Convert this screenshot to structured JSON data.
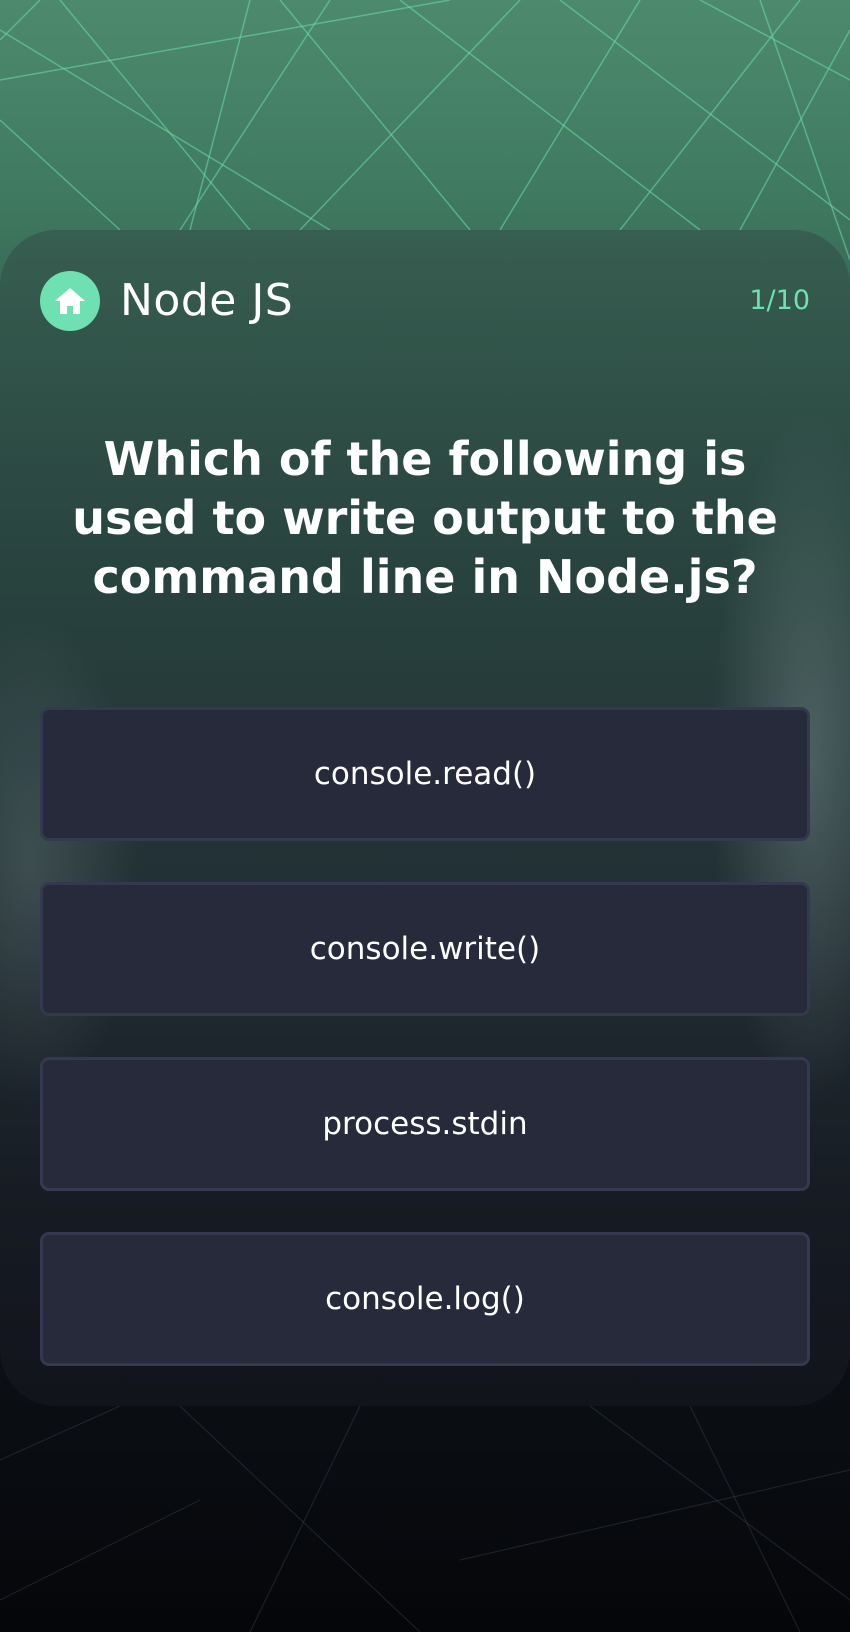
{
  "header": {
    "home_icon": "home-icon",
    "title": "Node JS",
    "progress": "1/10"
  },
  "question": {
    "text": "Which of the following is used to write output to the command line in Node.js?"
  },
  "answers": [
    {
      "label": "console.read()"
    },
    {
      "label": "console.write()"
    },
    {
      "label": "process.stdin"
    },
    {
      "label": "console.log()"
    }
  ],
  "colors": {
    "accent": "#6fe0b2",
    "answer_bg": "#262a3a",
    "answer_border": "#343950",
    "text": "#ffffff"
  }
}
